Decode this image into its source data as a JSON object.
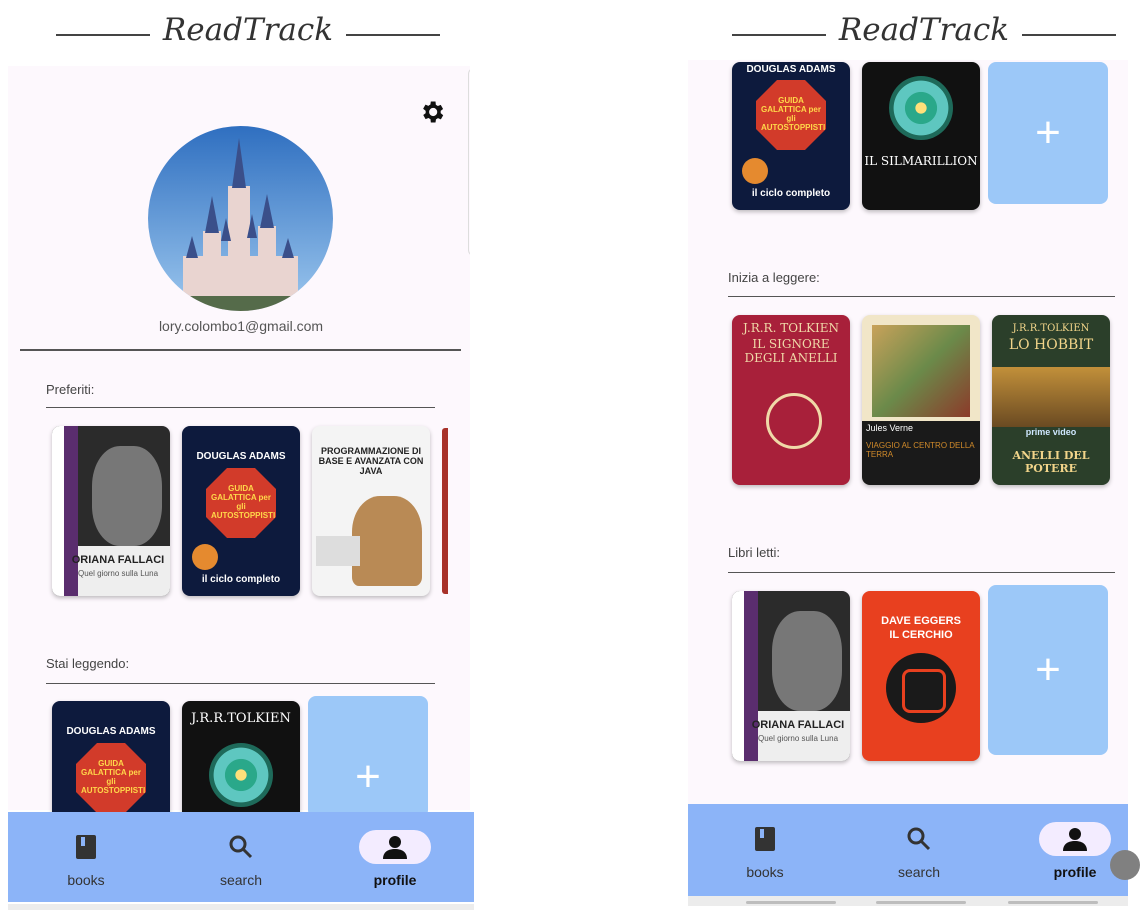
{
  "app": {
    "title": "ReadTrack"
  },
  "profile": {
    "email": "lory.colombo1@gmail.com"
  },
  "left": {
    "sections": {
      "favorites": {
        "label": "Preferiti:"
      },
      "reading": {
        "label": "Stai leggendo:"
      }
    },
    "books": {
      "b1": {
        "author": "ORIANA FALLACI",
        "title": "Quel giorno sulla Luna"
      },
      "b2": {
        "author": "DOUGLAS ADAMS",
        "title": "GUIDA GALATTICA per gli AUTOSTOPPISTI",
        "sub": "il ciclo completo"
      },
      "b3": {
        "title": "PROGRAMMAZIONE DI BASE E AVANZATA CON JAVA"
      },
      "b4": {
        "author": "DOUGLAS ADAMS",
        "title": "GUIDA GALATTICA per gli AUTOSTOPPISTI"
      },
      "b5": {
        "author": "J.R.R.TOLKIEN"
      }
    }
  },
  "right": {
    "sections": {
      "to_start": {
        "label": "Inizia a leggere:"
      },
      "read": {
        "label": "Libri letti:"
      }
    },
    "books": {
      "r1": {
        "author": "DOUGLAS ADAMS",
        "title": "GUIDA GALATTICA per gli AUTOSTOPPISTI",
        "sub": "il ciclo completo"
      },
      "r2": {
        "title": "IL SILMARILLION"
      },
      "r3": {
        "author": "J.R.R. TOLKIEN",
        "title": "IL SIGNORE DEGLI ANELLI"
      },
      "r4": {
        "author": "Jules Verne",
        "title": "VIAGGIO AL CENTRO DELLA TERRA"
      },
      "r5": {
        "author": "J.R.R.TOLKIEN",
        "title": "LO HOBBIT",
        "sub": "prime video",
        "sub2": "ANELLI DEL POTERE"
      },
      "r6": {
        "author": "ORIANA FALLACI",
        "title": "Quel giorno sulla Luna"
      },
      "r7": {
        "author": "DAVE EGGERS",
        "title": "IL CERCHIO"
      }
    }
  },
  "nav": {
    "books": "books",
    "search": "search",
    "profile": "profile"
  },
  "add_symbol": "+",
  "colors": {
    "nav_bg": "#8cb4f8",
    "add_tile": "#9cc8f8",
    "panel_bg": "#fdf8fd"
  }
}
